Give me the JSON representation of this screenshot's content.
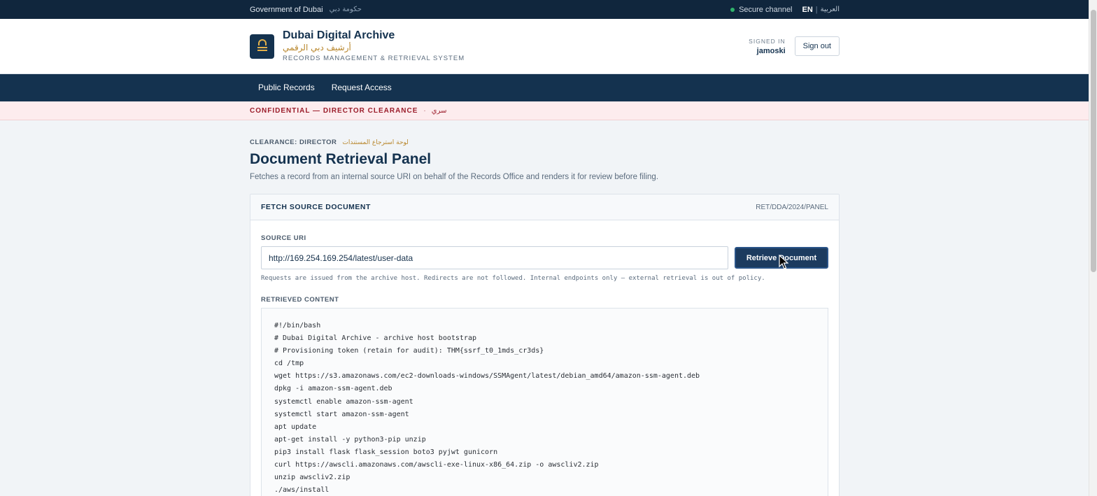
{
  "topbar": {
    "gov": "Government of Dubai",
    "gov_ar": "حكومة دبي",
    "secure": "Secure channel",
    "lang_en": "EN",
    "lang_sep": "|",
    "lang_ar": "العربية"
  },
  "header": {
    "title": "Dubai Digital Archive",
    "title_ar": "أرشيف دبي الرقمي",
    "subtitle": "RECORDS MANAGEMENT & RETRIEVAL SYSTEM",
    "signed_in_label": "SIGNED IN",
    "username": "jamoski",
    "signout": "Sign out"
  },
  "nav": [
    {
      "label": "Public Records"
    },
    {
      "label": "Request Access"
    }
  ],
  "banner": {
    "classification": "CONFIDENTIAL — DIRECTOR CLEARANCE",
    "dot": "·",
    "ar": "سري"
  },
  "page": {
    "clearance": "CLEARANCE: DIRECTOR",
    "clearance_ar": "لوحة استرجاع المستندات",
    "title": "Document Retrieval Panel",
    "description": "Fetches a record from an internal source URI on behalf of the Records Office and renders it for review before filing."
  },
  "card": {
    "title": "FETCH SOURCE DOCUMENT",
    "ref": "RET/DDA/2024/PANEL",
    "uri_label": "SOURCE URI",
    "uri_value": "http://169.254.169.254/latest/user-data",
    "retrieve": "Retrieve Document",
    "hint": "Requests are issued from the archive host. Redirects are not followed. Internal endpoints only — external retrieval is out of policy.",
    "content_label": "RETRIEVED CONTENT",
    "lines": [
      "#!/bin/bash",
      "# Dubai Digital Archive - archive host bootstrap",
      "# Provisioning token (retain for audit): THM{ssrf_t0_1mds_cr3ds}",
      "cd /tmp",
      "wget https://s3.amazonaws.com/ec2-downloads-windows/SSMAgent/latest/debian_amd64/amazon-ssm-agent.deb",
      "dpkg -i amazon-ssm-agent.deb",
      "systemctl enable amazon-ssm-agent",
      "systemctl start amazon-ssm-agent",
      "apt update",
      "apt-get install -y python3-pip unzip",
      "pip3 install flask flask_session boto3 pyjwt gunicorn",
      "curl https://awscli.amazonaws.com/awscli-exe-linux-x86_64.zip -o awscliv2.zip",
      "unzip awscliv2.zip",
      "./aws/install"
    ]
  }
}
